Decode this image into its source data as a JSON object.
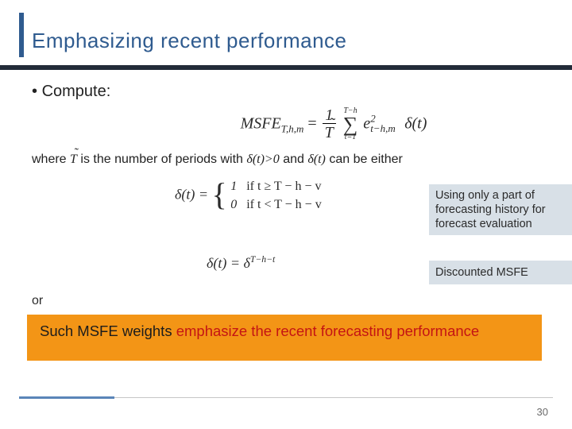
{
  "title": "Emphasizing recent performance",
  "bullet1": "Compute:",
  "formula_main": {
    "lhs_base": "MSFE",
    "lhs_sub": "T,h,m",
    "frac_num": "1",
    "frac_den": "T",
    "sum_top": "T−h",
    "sum_bot": "t=1",
    "e_base": "e",
    "e_sup": "2",
    "e_sub": "t−h,m",
    "tail": "δ(t)"
  },
  "where": {
    "prefix": "where ",
    "T_sym": "T",
    "mid": " is the number of periods with ",
    "cond": "δ(t)>0",
    "mid2": " and ",
    "dt": "δ(t)",
    "suffix": " can be either"
  },
  "delta_piecewise": {
    "lhs": "δ(t) = ",
    "case1_val": "1",
    "case1_cond": "if  t ≥ T − h − v",
    "case2_val": "0",
    "case2_cond": "if  t < T − h − v"
  },
  "callout1": "Using only a part of forecasting history for forecast evaluation",
  "or_text": "or",
  "delta_exp": {
    "lhs": "δ(t) = δ",
    "sup": "T−h−t"
  },
  "callout2": "Discounted MSFE",
  "highlight": {
    "black": "Such MSFE weights ",
    "red": "emphasize the recent forecasting performance"
  },
  "slidenum": "30"
}
